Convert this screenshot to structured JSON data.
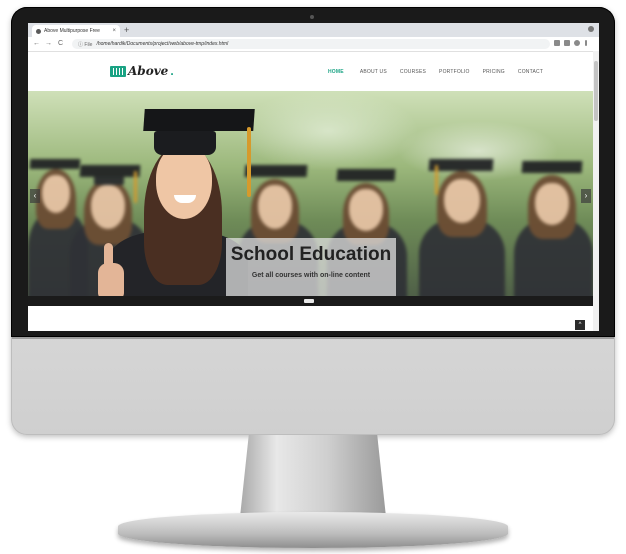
{
  "browser": {
    "tab_title": "Above Multipurpose Free",
    "new_tab_symbol": "+",
    "tab_close_symbol": "×",
    "url_info": "ⓘ File",
    "url": "/home/hardik/Documents/project/web/above-tmp/index.html",
    "back_symbol": "←",
    "forward_symbol": "→",
    "reload_symbol": "C",
    "icons": [
      "star-icon",
      "extension-icon",
      "profile-icon",
      "menu-icon"
    ]
  },
  "site": {
    "logo_text": "Above",
    "logo_dot": ".",
    "brand_color": "#1aa384",
    "nav": [
      "HOME",
      "ABOUT US",
      "COURSES",
      "PORTFOLIO",
      "PRICING",
      "CONTACT"
    ],
    "nav_active_index": 0
  },
  "hero": {
    "title": "School Education",
    "subtitle": "Get all courses with on-line content",
    "prev_symbol": "‹",
    "next_symbol": "›"
  },
  "back_to_top_symbol": "^"
}
